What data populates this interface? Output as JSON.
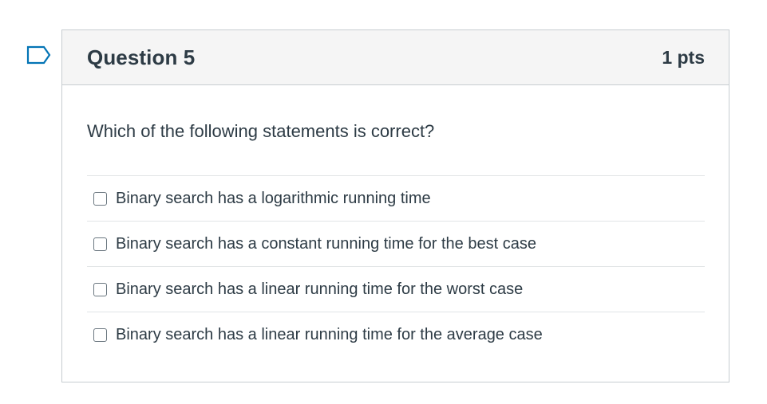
{
  "question": {
    "title": "Question 5",
    "points": "1 pts",
    "text": "Which of the following statements is correct?",
    "flag_icon": "flag-bookmark-icon",
    "answers": [
      {
        "label": "Binary search has a logarithmic running time",
        "checked": false
      },
      {
        "label": "Binary search has a constant running time for the best case",
        "checked": false
      },
      {
        "label": "Binary search has a linear running time for the worst case",
        "checked": false
      },
      {
        "label": "Binary search has a linear running time for the average case",
        "checked": false
      }
    ]
  },
  "colors": {
    "accent": "#0374b5",
    "text": "#2d3b45",
    "border": "#c7cdd1",
    "header_bg": "#f5f5f5"
  }
}
